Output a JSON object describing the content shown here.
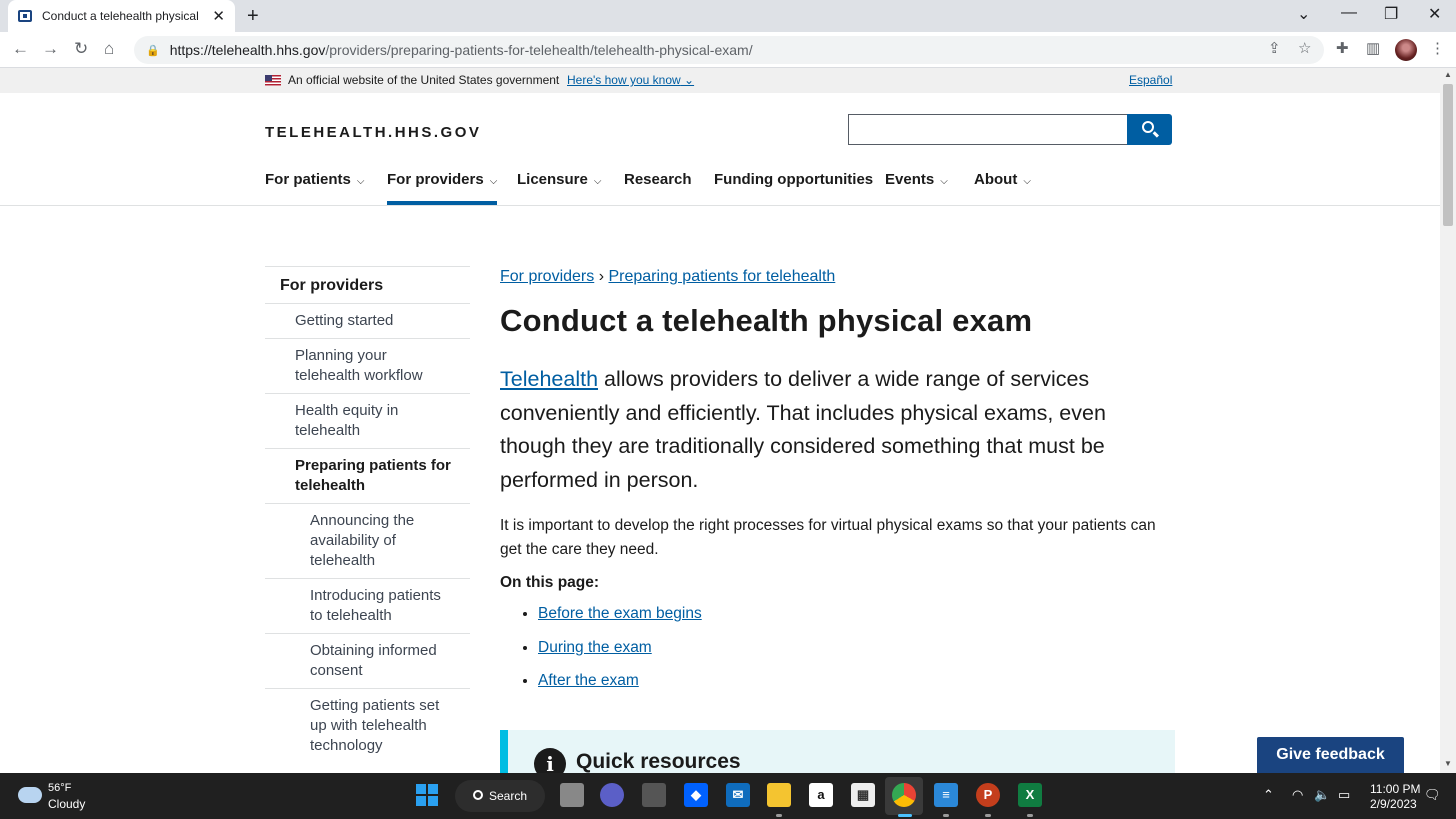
{
  "browser": {
    "tab_title": "Conduct a telehealth physical ex",
    "url_host": "https://telehealth.hhs.gov",
    "url_path": "/providers/preparing-patients-for-telehealth/telehealth-physical-exam/"
  },
  "gov_banner": {
    "official_text": "An official website of the United States government",
    "how_you_know": "Here's how you know",
    "language_link": "Español"
  },
  "header": {
    "logo": "TELEHEALTH.HHS.GOV",
    "search_placeholder": ""
  },
  "nav": [
    {
      "label": "For patients",
      "has_dropdown": true
    },
    {
      "label": "For providers",
      "has_dropdown": true,
      "active": true
    },
    {
      "label": "Licensure",
      "has_dropdown": true
    },
    {
      "label": "Research",
      "has_dropdown": false
    },
    {
      "label": "Funding opportunities",
      "has_dropdown": false
    },
    {
      "label": "Events",
      "has_dropdown": true
    },
    {
      "label": "About",
      "has_dropdown": true
    }
  ],
  "sidenav": {
    "heading": "For providers",
    "items": [
      "Getting started",
      "Planning your telehealth workflow",
      "Health equity in telehealth",
      "Preparing patients for telehealth"
    ],
    "subitems": [
      "Announcing the availability of telehealth",
      "Introducing patients to telehealth",
      "Obtaining informed consent",
      "Getting patients set up with telehealth technology"
    ]
  },
  "main": {
    "breadcrumb": [
      "For providers",
      "Preparing patients for telehealth"
    ],
    "breadcrumb_sep": "›",
    "title": "Conduct a telehealth physical exam",
    "lead_link": "Telehealth",
    "lead_rest": " allows providers to deliver a wide range of services conveniently and efficiently. That includes physical exams, even though they are traditionally considered something that must be performed in person.",
    "body": "It is important to develop the right processes for virtual physical exams so that your patients can get the care they need.",
    "on_this_page": "On this page:",
    "toc": [
      "Before the exam begins",
      "During the exam",
      "After the exam"
    ],
    "quick_resources": "Quick resources",
    "feedback_button": "Give feedback"
  },
  "taskbar": {
    "weather_temp": "56°F",
    "weather_cond": "Cloudy",
    "search_label": "Search",
    "time": "11:00 PM",
    "date": "2/9/2023"
  },
  "colors": {
    "link": "#005ea2",
    "feedback_bg": "#1a4480",
    "callout_bg": "#e7f6f8",
    "callout_border": "#00bde3"
  }
}
